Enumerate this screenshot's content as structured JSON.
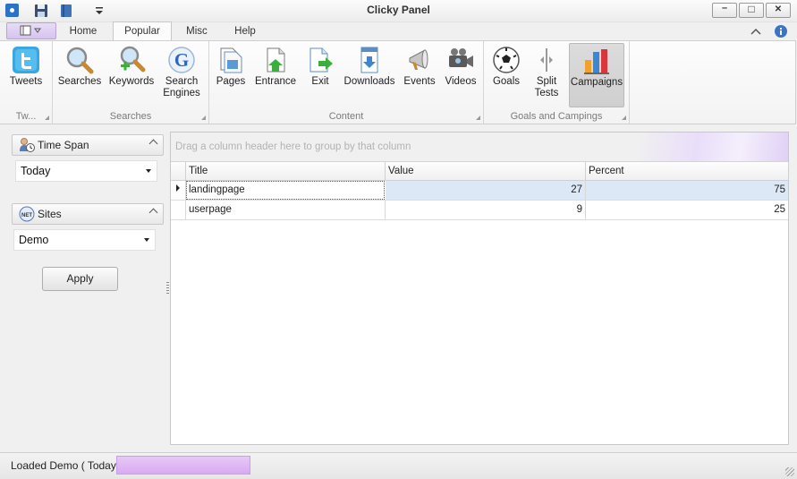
{
  "window": {
    "title": "Clicky Panel"
  },
  "tabs": [
    {
      "label": "Home",
      "active": false
    },
    {
      "label": "Popular",
      "active": true
    },
    {
      "label": "Misc",
      "active": false
    },
    {
      "label": "Help",
      "active": false
    }
  ],
  "ribbon": {
    "groups": [
      {
        "label": "Tw...",
        "buttons": [
          {
            "label": "Tweets",
            "icon": "twitter-icon"
          }
        ]
      },
      {
        "label": "Searches",
        "buttons": [
          {
            "label": "Searches",
            "icon": "magnifier-icon"
          },
          {
            "label": "Keywords",
            "icon": "magnifier-plus-icon"
          },
          {
            "label": "Search Engines",
            "icon": "google-icon"
          }
        ]
      },
      {
        "label": "Content",
        "buttons": [
          {
            "label": "Pages",
            "icon": "pages-icon"
          },
          {
            "label": "Entrance",
            "icon": "entrance-icon"
          },
          {
            "label": "Exit",
            "icon": "exit-icon"
          },
          {
            "label": "Downloads",
            "icon": "download-icon"
          },
          {
            "label": "Events",
            "icon": "megaphone-icon"
          },
          {
            "label": "Videos",
            "icon": "video-camera-icon"
          }
        ]
      },
      {
        "label": "Goals and Campings",
        "buttons": [
          {
            "label": "Goals",
            "icon": "soccer-ball-icon"
          },
          {
            "label": "Split Tests",
            "icon": "split-icon"
          },
          {
            "label": "Campaigns",
            "icon": "bar-chart-icon",
            "selected": true
          }
        ]
      }
    ]
  },
  "left_panel": {
    "time_span": {
      "title": "Time Span",
      "selected": "Today",
      "icon": "clock-person-icon"
    },
    "sites": {
      "title": "Sites",
      "selected": "Demo",
      "icon": "net-globe-icon"
    },
    "apply_label": "Apply"
  },
  "grid": {
    "group_hint": "Drag a column header here to group by that column",
    "columns": [
      "Title",
      "Value",
      "Percent"
    ],
    "rows": [
      {
        "title": "landingpage",
        "value": "27",
        "percent": "75"
      },
      {
        "title": "userpage",
        "value": "9",
        "percent": "25"
      }
    ]
  },
  "status": {
    "text": "Loaded Demo ( Today )"
  },
  "colors": {
    "accent": "#2d72c6",
    "selection": "#dde8f7",
    "progress": "#ddb0f2"
  }
}
